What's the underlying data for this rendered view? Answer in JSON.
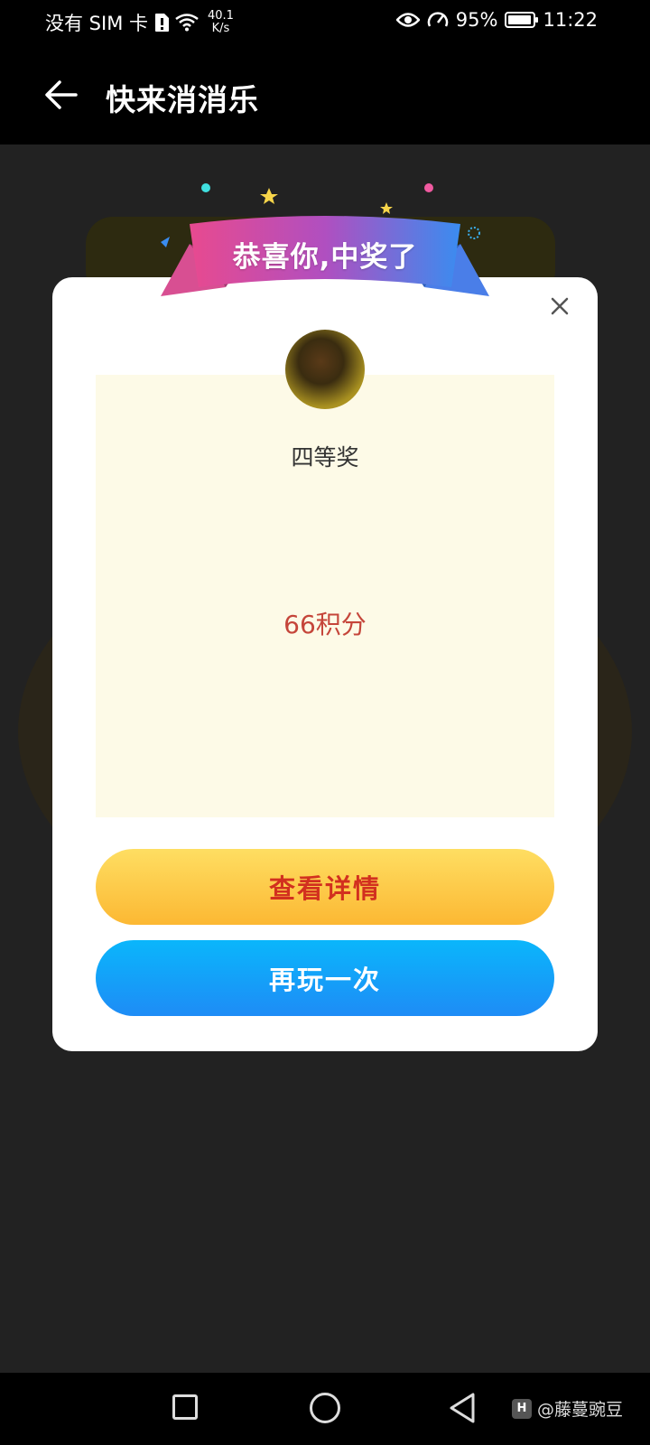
{
  "status_bar": {
    "carrier": "没有 SIM 卡",
    "speed_value": "40.1",
    "speed_unit": "K/s",
    "battery": "95%",
    "battery_level": 0.95,
    "time": "11:22"
  },
  "app_bar": {
    "title": "快来消消乐"
  },
  "modal": {
    "banner": "恭喜你,中奖了",
    "prize_name": "四等奖",
    "prize_value": "66积分",
    "details_button": "查看详情",
    "replay_button": "再玩一次"
  },
  "nav_bar": {
    "watermark": "@藤蔓豌豆"
  },
  "icons": [
    "sim-alert-icon",
    "wifi-icon",
    "eye-icon",
    "speedometer-icon",
    "battery-icon",
    "back-arrow-icon",
    "close-icon",
    "nav-recents-icon",
    "nav-home-icon",
    "nav-back-icon"
  ],
  "colors": {
    "details_text": "#d2301f",
    "details_bg": "#fcc23e",
    "replay_bg": "#139ff8",
    "prize_value": "#c5453a",
    "prize_panel": "#fdfae7"
  }
}
